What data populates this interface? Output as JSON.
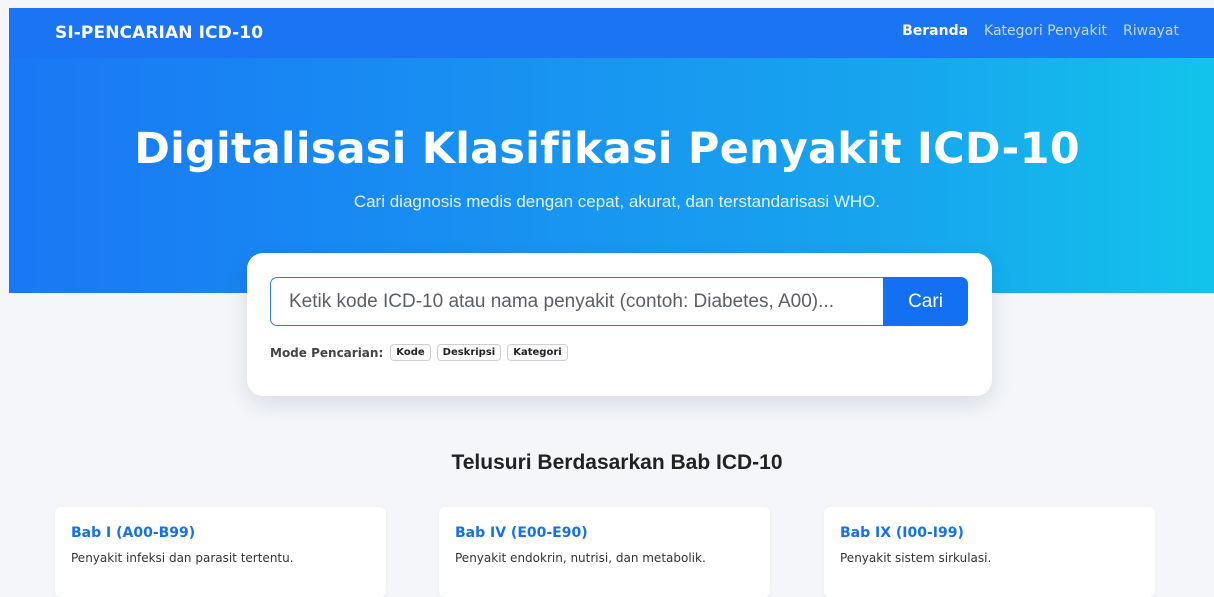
{
  "navbar": {
    "brand": "SI-PENCARIAN ICD-10",
    "links": [
      {
        "label": "Beranda",
        "active": true
      },
      {
        "label": "Kategori Penyakit",
        "active": false
      },
      {
        "label": "Riwayat",
        "active": false
      }
    ]
  },
  "hero": {
    "title": "Digitalisasi Klasifikasi Penyakit ICD-10",
    "subtitle": "Cari diagnosis medis dengan cepat, akurat, dan terstandarisasi WHO."
  },
  "search": {
    "placeholder": "Ketik kode ICD-10 atau nama penyakit (contoh: Diabetes, A00)...",
    "value": "",
    "button_label": "Cari",
    "mode_label": "Mode Pencarian:",
    "modes": [
      "Kode",
      "Deskripsi",
      "Kategori"
    ]
  },
  "chapters": {
    "title": "Telusuri Berdasarkan Bab ICD-10",
    "items": [
      {
        "title": "Bab I (A00-B99)",
        "desc": "Penyakit infeksi dan parasit tertentu."
      },
      {
        "title": "Bab IV (E00-E90)",
        "desc": "Penyakit endokrin, nutrisi, dan metabolik."
      },
      {
        "title": "Bab IX (I00-I99)",
        "desc": "Penyakit sistem sirkulasi."
      }
    ]
  },
  "colors": {
    "primary": "#1a74f3",
    "gradient_end": "#12c4eb",
    "link": "#1570ef",
    "background": "#f4f6f9"
  }
}
